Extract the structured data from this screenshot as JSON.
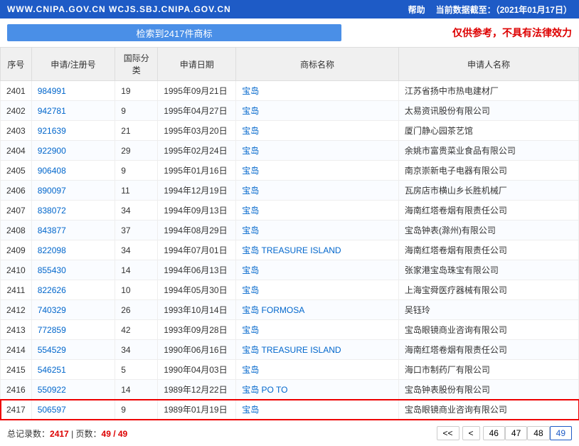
{
  "topbar": {
    "urls": "WWW.CNIPA.GOV.CN  WCJS.SBJ.CNIPA.GOV.CN",
    "help": "帮助",
    "date_prefix": "当前数据截至：",
    "date": "（2021年01月17日）"
  },
  "search": {
    "label": "检索到2417件商标"
  },
  "warn": "仅供参考，不具有法律效力",
  "columns": [
    "序号",
    "申请/注册号",
    "国际分类",
    "申请日期",
    "商标名称",
    "申请人名称"
  ],
  "rows": [
    {
      "idx": "2401",
      "reg": "984991",
      "cls": "19",
      "date": "1995年09月21日",
      "name": "宝岛",
      "app": "江苏省扬中市热电建材厂"
    },
    {
      "idx": "2402",
      "reg": "942781",
      "cls": "9",
      "date": "1995年04月27日",
      "name": "宝岛",
      "app": "太易资讯股份有限公司"
    },
    {
      "idx": "2403",
      "reg": "921639",
      "cls": "21",
      "date": "1995年03月20日",
      "name": "宝岛",
      "app": "厦门静心园茶艺馆"
    },
    {
      "idx": "2404",
      "reg": "922900",
      "cls": "29",
      "date": "1995年02月24日",
      "name": "宝岛",
      "app": "余姚市富贵菜业食品有限公司"
    },
    {
      "idx": "2405",
      "reg": "906408",
      "cls": "9",
      "date": "1995年01月16日",
      "name": "宝岛",
      "app": "南京崇新电子电器有限公司"
    },
    {
      "idx": "2406",
      "reg": "890097",
      "cls": "11",
      "date": "1994年12月19日",
      "name": "宝岛",
      "app": "瓦房店市横山乡长胜机械厂"
    },
    {
      "idx": "2407",
      "reg": "838072",
      "cls": "34",
      "date": "1994年09月13日",
      "name": "宝岛",
      "app": "海南红塔卷烟有限责任公司"
    },
    {
      "idx": "2408",
      "reg": "843877",
      "cls": "37",
      "date": "1994年08月29日",
      "name": "宝岛",
      "app": "宝岛钟表(滁州)有限公司"
    },
    {
      "idx": "2409",
      "reg": "822098",
      "cls": "34",
      "date": "1994年07月01日",
      "name": "宝岛 TREASURE ISLAND",
      "app": "海南红塔卷烟有限责任公司"
    },
    {
      "idx": "2410",
      "reg": "855430",
      "cls": "14",
      "date": "1994年06月13日",
      "name": "宝岛",
      "app": "张家港宝岛珠宝有限公司"
    },
    {
      "idx": "2411",
      "reg": "822626",
      "cls": "10",
      "date": "1994年05月30日",
      "name": "宝岛",
      "app": "上海宝舜医疗器械有限公司"
    },
    {
      "idx": "2412",
      "reg": "740329",
      "cls": "26",
      "date": "1993年10月14日",
      "name": "宝岛 FORMOSA",
      "app": "吴钰玲"
    },
    {
      "idx": "2413",
      "reg": "772859",
      "cls": "42",
      "date": "1993年09月28日",
      "name": "宝岛",
      "app": "宝岛眼镜商业咨询有限公司"
    },
    {
      "idx": "2414",
      "reg": "554529",
      "cls": "34",
      "date": "1990年06月16日",
      "name": "宝岛 TREASURE ISLAND",
      "app": "海南红塔卷烟有限责任公司"
    },
    {
      "idx": "2415",
      "reg": "546251",
      "cls": "5",
      "date": "1990年04月03日",
      "name": "宝岛",
      "app": "海口市制药厂有限公司"
    },
    {
      "idx": "2416",
      "reg": "550922",
      "cls": "14",
      "date": "1989年12月22日",
      "name": "宝岛 PO TO",
      "app": "宝岛钟表股份有限公司"
    },
    {
      "idx": "2417",
      "reg": "506597",
      "cls": "9",
      "date": "1989年01月19日",
      "name": "宝岛",
      "app": "宝岛眼镜商业咨询有限公司",
      "hl": true
    }
  ],
  "footer": {
    "total_label": "总记录数：",
    "total": "2417",
    "page_label": "页数：",
    "page": "49 / 49"
  },
  "pagination": {
    "first": "<<",
    "prev": "<",
    "pages": [
      "46",
      "47",
      "48",
      "49"
    ],
    "active": "49"
  }
}
